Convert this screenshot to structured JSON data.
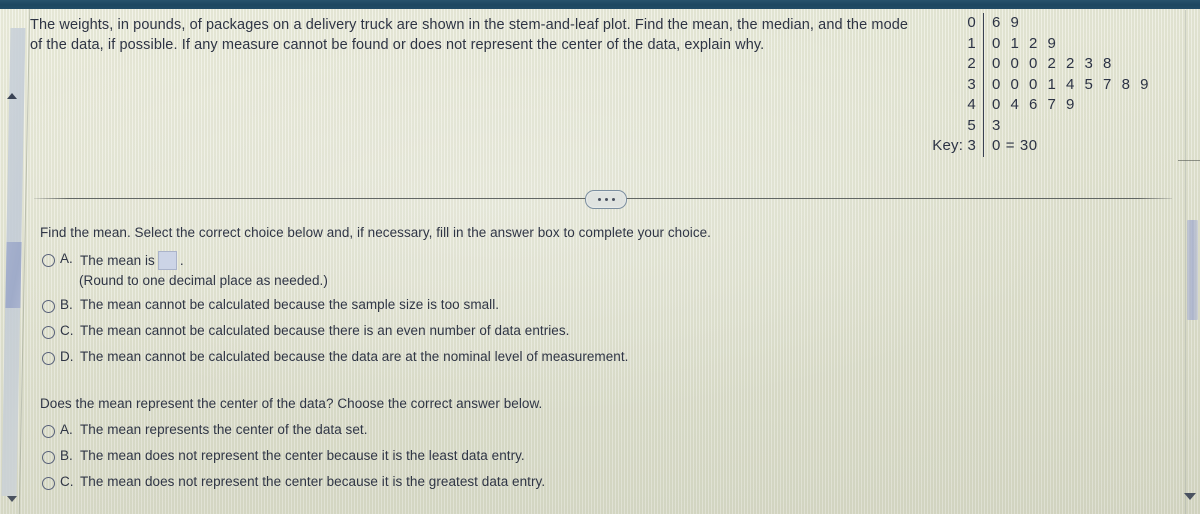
{
  "prompt": {
    "line1": "The weights, in pounds, of packages on a delivery truck are shown in the stem-and-leaf plot. Find the mean, the median, and the mode",
    "line2": "of the data, if possible. If any measure cannot be found or does not represent the center of the data, explain why."
  },
  "stem_leaf_plot": {
    "rows": [
      {
        "stem": "0",
        "leaves": "6 9"
      },
      {
        "stem": "1",
        "leaves": "0 1 2 9"
      },
      {
        "stem": "2",
        "leaves": "0 0 0 2 2 3 8"
      },
      {
        "stem": "3",
        "leaves": "0 0 0 1 4 5 7 8 9"
      },
      {
        "stem": "4",
        "leaves": "0 4 6 7 9"
      },
      {
        "stem": "5",
        "leaves": "3"
      }
    ],
    "key": {
      "label": "Key: 3",
      "value": "0 = 30"
    }
  },
  "divider": {
    "ellipsis_label": "..."
  },
  "question1": {
    "text": "Find the mean. Select the correct choice below and, if necessary, fill in the answer box to complete your choice.",
    "choices": [
      {
        "letter": "A.",
        "text_before": "The mean is",
        "text_after": ".",
        "has_answer_box": true
      },
      {
        "letter": "B.",
        "text": "The mean cannot be calculated because the sample size is too small."
      },
      {
        "letter": "C.",
        "text": "The mean cannot be calculated because there is an even number of data entries."
      },
      {
        "letter": "D.",
        "text": "The mean cannot be calculated because the data are at the nominal level of measurement."
      }
    ],
    "rounding_note": "(Round to one decimal place as needed.)"
  },
  "question2": {
    "text": "Does the mean represent the center of the data? Choose the correct answer below.",
    "choices": [
      {
        "letter": "A.",
        "text": "The mean represents the center of the data set."
      },
      {
        "letter": "B.",
        "text": "The mean does not represent the center because it is the least data entry."
      },
      {
        "letter": "C.",
        "text": "The mean does not represent the center because it is the greatest data entry."
      }
    ]
  },
  "colors": {
    "topbar": "#1d4760",
    "page_background": "#e9ead9",
    "text": "#2f3545",
    "answer_box": "#ccd4e6",
    "scrollbar_thumb": "#a6b1cd"
  }
}
